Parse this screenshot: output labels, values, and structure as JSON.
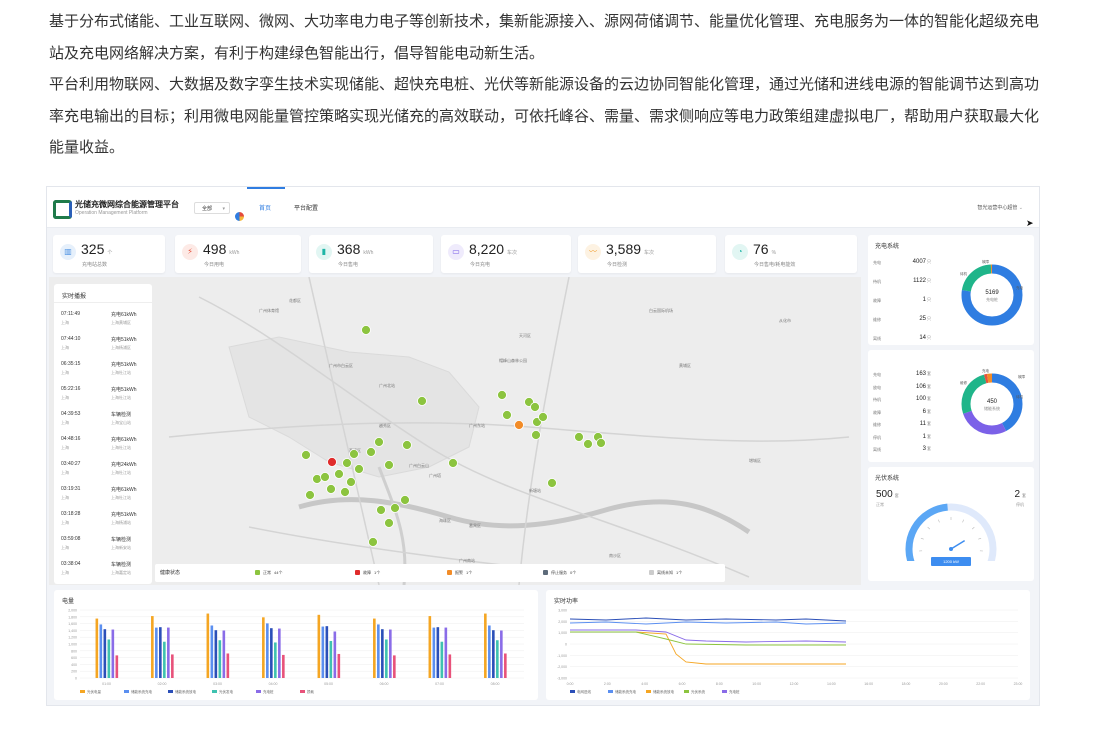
{
  "intro": {
    "p1": "基于分布式储能、工业互联网、微网、大功率电力电子等创新技术，集新能源接入、源网荷储调节、能量优化管理、充电服务为一体的智能化超级充电站及充电网络解决方案，有利于构建绿色智能出行，倡导智能电动新生活。",
    "p2": "平台利用物联网、大数据及数字孪生技术实现储能、超快充电桩、光伏等新能源设备的云边协同智能化管理，通过光储和进线电源的智能调节达到高功率充电输出的目标；利用微电网能量管控策略实现光储充的高效联动，可依托峰谷、需量、需求侧响应等电力政策组建虚拟电厂，帮助用户获取最大化能量收益。"
  },
  "app": {
    "title": "光储充微网综合能源管理平台",
    "subtitle": "Operation Management Platform",
    "selector": "全部",
    "tabs": [
      "首页",
      "平台配置"
    ],
    "user": "智光运营中心超管"
  },
  "stats": [
    {
      "value": "325",
      "unit": "个",
      "label": "充电站总数",
      "color": "#4a90e2",
      "bg": "#e6f0fb",
      "icon": "station-icon"
    },
    {
      "value": "498",
      "unit": "kWh",
      "label": "今日用电",
      "color": "#e5533d",
      "bg": "#fdeae6",
      "icon": "power-icon"
    },
    {
      "value": "368",
      "unit": "kWh",
      "label": "今日售电",
      "color": "#1fb5a6",
      "bg": "#e2f6f3",
      "icon": "battery-icon"
    },
    {
      "value": "8,220",
      "unit": "车次",
      "label": "今日充电",
      "color": "#7a5de8",
      "bg": "#efebfc",
      "icon": "car-icon"
    },
    {
      "value": "3,589",
      "unit": "车次",
      "label": "今日检测",
      "color": "#f2a23a",
      "bg": "#fdf2e2",
      "icon": "trend-icon"
    },
    {
      "value": "76",
      "unit": "%",
      "label": "今日售电/耗电能效",
      "color": "#1fb5a6",
      "bg": "#e2f6f3",
      "icon": "efficiency-icon"
    }
  ],
  "feed": {
    "title": "实时播报",
    "items": [
      {
        "time": "07:11:49",
        "city": "上海",
        "event": "充电61kWh",
        "place": "上海黄埔区"
      },
      {
        "time": "07:44:10",
        "city": "上海",
        "event": "充电51kWh",
        "place": "上海杨浦区"
      },
      {
        "time": "06:35:15",
        "city": "上海",
        "event": "充电51kWh",
        "place": "上海杜江站"
      },
      {
        "time": "05:22:16",
        "city": "上海",
        "event": "充电51kWh",
        "place": "上海杜江站"
      },
      {
        "time": "04:39:53",
        "city": "上海",
        "event": "车辆检测",
        "place": "上海宝山站"
      },
      {
        "time": "04:48:16",
        "city": "上海",
        "event": "充电61kWh",
        "place": "上海杜江站"
      },
      {
        "time": "03:40:27",
        "city": "上海",
        "event": "充电24kWh",
        "place": "上海杜江站"
      },
      {
        "time": "03:19:31",
        "city": "上海",
        "event": "充电61kWh",
        "place": "上海杜江站"
      },
      {
        "time": "03:18:28",
        "city": "上海",
        "event": "充电51kWh",
        "place": "上海杨浦站"
      },
      {
        "time": "03:59:08",
        "city": "上海",
        "event": "车辆检测",
        "place": "上海新安站"
      },
      {
        "time": "03:38:04",
        "city": "上海",
        "event": "车辆检测",
        "place": "上海嘉定站"
      }
    ]
  },
  "map": {
    "labels": [
      "广州体育馆",
      "广州市白云区",
      "广州北站",
      "广州东站",
      "广州塔",
      "白云国际机场",
      "花都区",
      "番禺区",
      "天河区",
      "黄埔区",
      "从化市",
      "广州南站",
      "增城区",
      "新塘站",
      "荔湾区",
      "越秀区",
      "海珠区",
      "南沙区",
      "广州白云山",
      "帽峰山森林公园"
    ]
  },
  "health": {
    "title": "健康状态",
    "items": [
      {
        "label": "正常",
        "count": "44个",
        "color": "#8cc43f"
      },
      {
        "label": "故障",
        "count": "1个",
        "color": "#e02b2b"
      },
      {
        "label": "报警",
        "count": "1个",
        "color": "#f28c28"
      },
      {
        "label": "停止服务",
        "count": "0个",
        "color": "#5d6b7a"
      },
      {
        "label": "离线未知",
        "count": "1个",
        "color": "#cccccc"
      }
    ]
  },
  "charge_panel": {
    "title": "充电系统",
    "rows": [
      {
        "label": "充电",
        "value": "4007",
        "unit": "只"
      },
      {
        "label": "待机",
        "value": "1122",
        "unit": "只"
      },
      {
        "label": "故障",
        "value": "1",
        "unit": "只"
      },
      {
        "label": "维修",
        "value": "25",
        "unit": "只"
      },
      {
        "label": "离线",
        "value": "14",
        "unit": "只"
      }
    ],
    "center_value": "5169",
    "center_label": "充电桩",
    "legend": [
      "待机",
      "故障",
      "充电"
    ],
    "segments": [
      {
        "value": 4007,
        "color": "#2f7de1"
      },
      {
        "value": 1122,
        "color": "#1fb58a"
      },
      {
        "value": 40,
        "color": "#f28c28"
      }
    ]
  },
  "storage_panel": {
    "rows": [
      {
        "label": "充电",
        "value": "163",
        "unit": "套"
      },
      {
        "label": "放电",
        "value": "106",
        "unit": "套"
      },
      {
        "label": "待机",
        "value": "100",
        "unit": "套"
      },
      {
        "label": "故障",
        "value": "6",
        "unit": "套"
      },
      {
        "label": "维修",
        "value": "11",
        "unit": "套"
      },
      {
        "label": "停机",
        "value": "1",
        "unit": "套"
      },
      {
        "label": "离线",
        "value": "3",
        "unit": "套"
      }
    ],
    "center_value": "450",
    "center_label": "储能系统",
    "legend": [
      "维修",
      "充电",
      "待机",
      "故障"
    ],
    "segments": [
      {
        "value": 163,
        "color": "#2f7de1"
      },
      {
        "value": 106,
        "color": "#7b61e8"
      },
      {
        "value": 100,
        "color": "#1fb58a"
      },
      {
        "value": 6,
        "color": "#e5533d"
      },
      {
        "value": 11,
        "color": "#f28c28"
      }
    ]
  },
  "pv_panel": {
    "title": "光伏系统",
    "left_value": "500",
    "left_unit": "套",
    "left_label": "正常",
    "right_value": "2",
    "right_unit": "套",
    "right_label": "停机",
    "gauge_reading": "1200 kW",
    "gauge_fraction": 0.3
  },
  "energy_chart": {
    "title": "电量",
    "legend": [
      "光伏电量",
      "储能系统充电",
      "储能系统放电",
      "光伏发电",
      "充电桩",
      "损耗"
    ],
    "colors": [
      "#f5a623",
      "#5b8ff0",
      "#2b4fb8",
      "#3fc2b0",
      "#8a6ce8",
      "#e8527a"
    ],
    "categories": [
      "01:00",
      "02:00",
      "03:00",
      "04:00",
      "05:00",
      "06:00",
      "07:00",
      "08:00"
    ],
    "yticks": [
      "2,000",
      "1,800",
      "1,600",
      "1,400",
      "1,200",
      "1,000",
      "800",
      "600",
      "400",
      "200",
      "0"
    ]
  },
  "power_chart": {
    "title": "实时功率",
    "legend": [
      "电网进线",
      "储能系统充电",
      "储能系统放电",
      "光伏系统",
      "充电桩"
    ],
    "colors": [
      "#2b4fb8",
      "#5b8ff0",
      "#f5a623",
      "#8cc43f",
      "#8a6ce8"
    ],
    "xticks": [
      "0:00",
      "2:00",
      "4:00",
      "6:00",
      "8:00",
      "10:00",
      "12:00",
      "14:00",
      "16:00",
      "18:00",
      "20:00",
      "22:00",
      "23:00"
    ],
    "yticks": [
      "3,000",
      "2,000",
      "1,000",
      "0",
      "-1,000",
      "-2,000",
      "-3,000"
    ]
  }
}
